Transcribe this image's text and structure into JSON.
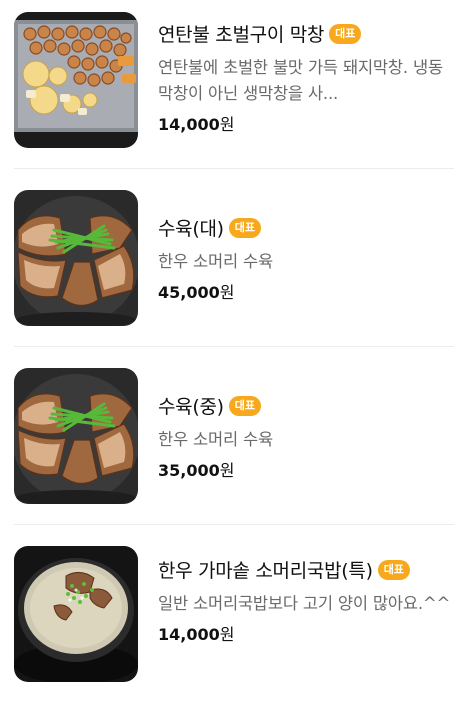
{
  "menu": {
    "badge_label": "대표",
    "currency_suffix": "원",
    "items": [
      {
        "name": "연탄불 초벌구이 막창",
        "description": "연탄불에 초벌한 불맛 가득 돼지막창. 냉동 막창이 아닌 생막창을 사...",
        "price": "14,000",
        "image": "grilled-makchang-photo"
      },
      {
        "name": "수육(대)",
        "description": "한우 소머리 수육",
        "price": "45,000",
        "image": "beef-head-suyuk-photo"
      },
      {
        "name": "수육(중)",
        "description": "한우 소머리 수육",
        "price": "35,000",
        "image": "beef-head-suyuk-photo"
      },
      {
        "name": "한우 가마솥 소머리국밥(특)",
        "description": "일반 소머리국밥보다 고기 양이 많아요.^^",
        "price": "14,000",
        "image": "beef-head-soup-photo"
      }
    ]
  },
  "colors": {
    "badge_bg": "#f8a81c",
    "description_text": "#6a6a6a",
    "divider": "#ececec"
  }
}
